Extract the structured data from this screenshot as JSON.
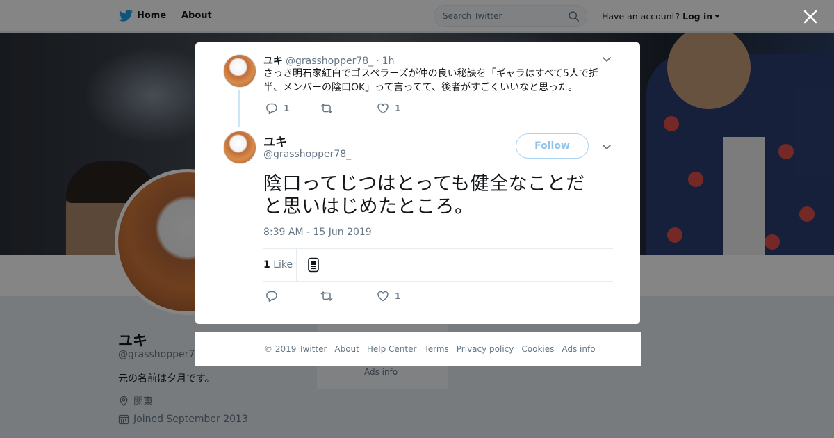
{
  "header": {
    "home_label": "Home",
    "about_label": "About",
    "search_placeholder": "Search Twitter",
    "account_prompt": "Have an account?",
    "login_label": "Log in",
    "brand_color": "#1da1f2"
  },
  "profile": {
    "name": "ユキ",
    "handle": "@grasshopper78_",
    "bio": "元の名前は夕月です。",
    "location": "関東",
    "joined": "Joined September 2013",
    "side_ads": "Ads info"
  },
  "modal": {
    "parent_tweet": {
      "name": "ユキ",
      "handle": "@grasshopper78_",
      "separator": "·",
      "time": "1h",
      "text": "さっき明石家紅白でゴスペラーズが仲の良い秘訣を「ギャラはすべて5人で折半、メンバーの陰口OK」って言ってて、後者がすごくいいなと思った。",
      "reply_count": "1",
      "retweet_count": "",
      "like_count": "1"
    },
    "main_tweet": {
      "name": "ユキ",
      "handle": "@grasshopper78_",
      "follow_label": "Follow",
      "text": "陰口ってじつはとっても健全なことだと思いはじめたところ。",
      "timestamp": "8:39 AM - 15 Jun 2019",
      "likes_count": "1",
      "likes_label": "Like",
      "reply_count": "",
      "retweet_count": "",
      "like_count": "1"
    }
  },
  "footer": {
    "links": [
      "© 2019 Twitter",
      "About",
      "Help Center",
      "Terms",
      "Privacy policy",
      "Cookies",
      "Ads info"
    ]
  }
}
